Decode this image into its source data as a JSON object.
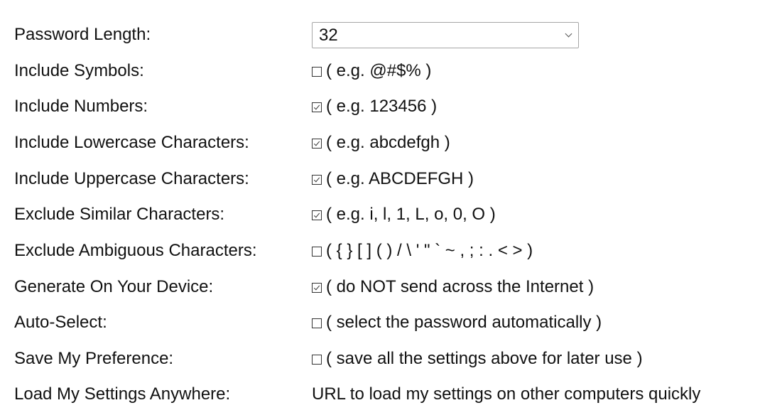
{
  "settings": {
    "password_length": {
      "label": "Password Length:",
      "value": "32"
    },
    "include_symbols": {
      "label": "Include Symbols:",
      "checked": false,
      "hint": "( e.g. @#$% )"
    },
    "include_numbers": {
      "label": "Include Numbers:",
      "checked": true,
      "hint": "( e.g. 123456 )"
    },
    "include_lowercase": {
      "label": "Include Lowercase Characters:",
      "checked": true,
      "hint": "( e.g. abcdefgh )"
    },
    "include_uppercase": {
      "label": "Include Uppercase Characters:",
      "checked": true,
      "hint": "( e.g. ABCDEFGH )"
    },
    "exclude_similar": {
      "label": "Exclude Similar Characters:",
      "checked": true,
      "hint": "( e.g. i, l, 1, L, o, 0, O )"
    },
    "exclude_ambiguous": {
      "label": "Exclude Ambiguous Characters:",
      "checked": false,
      "hint": "( { } [ ] ( ) / \\ ' \" ` ~ , ; : . < > )"
    },
    "generate_on_device": {
      "label": "Generate On Your Device:",
      "checked": true,
      "hint": "( do NOT send across the Internet )"
    },
    "auto_select": {
      "label": "Auto-Select:",
      "checked": false,
      "hint": "( select the password automatically )"
    },
    "save_preference": {
      "label": "Save My Preference:",
      "checked": false,
      "hint": "( save all the settings above for later use )"
    },
    "load_settings_anywhere": {
      "label": "Load My Settings Anywhere:",
      "link_text": "URL to load my settings on other computers quickly"
    }
  }
}
